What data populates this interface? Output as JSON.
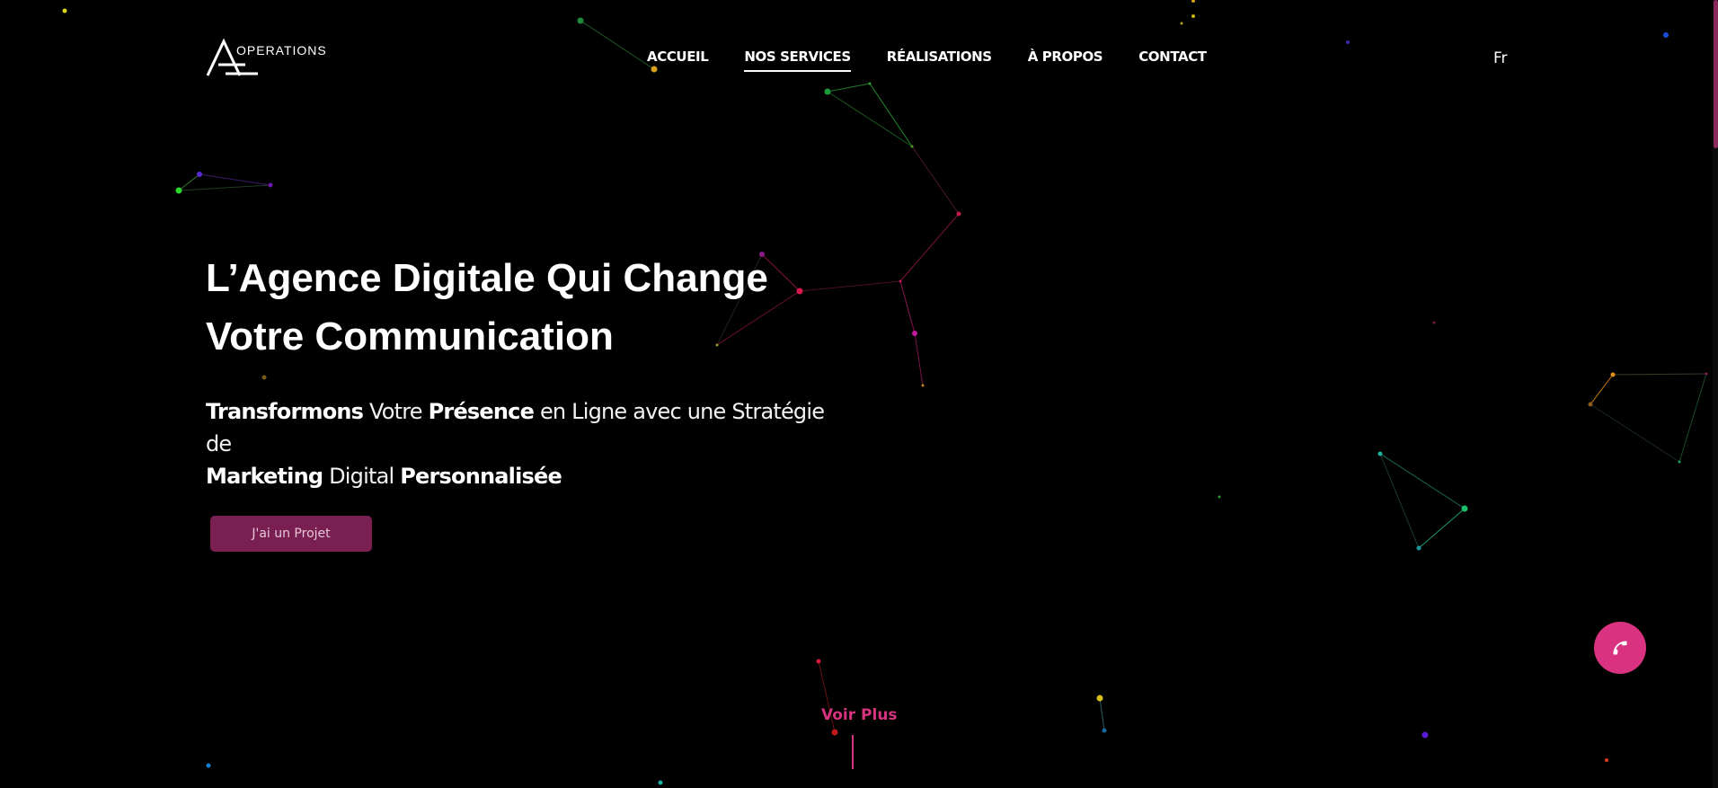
{
  "logo": {
    "wordmark": "OPERATIONS"
  },
  "nav": {
    "items": [
      {
        "label": "ACCUEIL"
      },
      {
        "label": "NOS SERVICES"
      },
      {
        "label": "RÉALISATIONS"
      },
      {
        "label": "À PROPOS"
      },
      {
        "label": "CONTACT"
      }
    ],
    "active_index": 1
  },
  "language": "Fr",
  "hero": {
    "title_line1": "L’Agence Digitale Qui Change",
    "title_line2": "Votre Communication",
    "subtitle": {
      "w1": "Transformons",
      "w2": "Votre",
      "w3": "Présence",
      "w4": "en Ligne avec une Stratégie de",
      "w5": "Marketing",
      "w6": "Digital",
      "w7": "Personnalisée"
    },
    "cta_label": "J'ai un Projet"
  },
  "scroll_hint": "Voir Plus",
  "icons": {
    "phone": "phone-icon"
  },
  "colors": {
    "accent": "#d93280",
    "cta_bg": "#7a1f52",
    "background": "#000000"
  }
}
